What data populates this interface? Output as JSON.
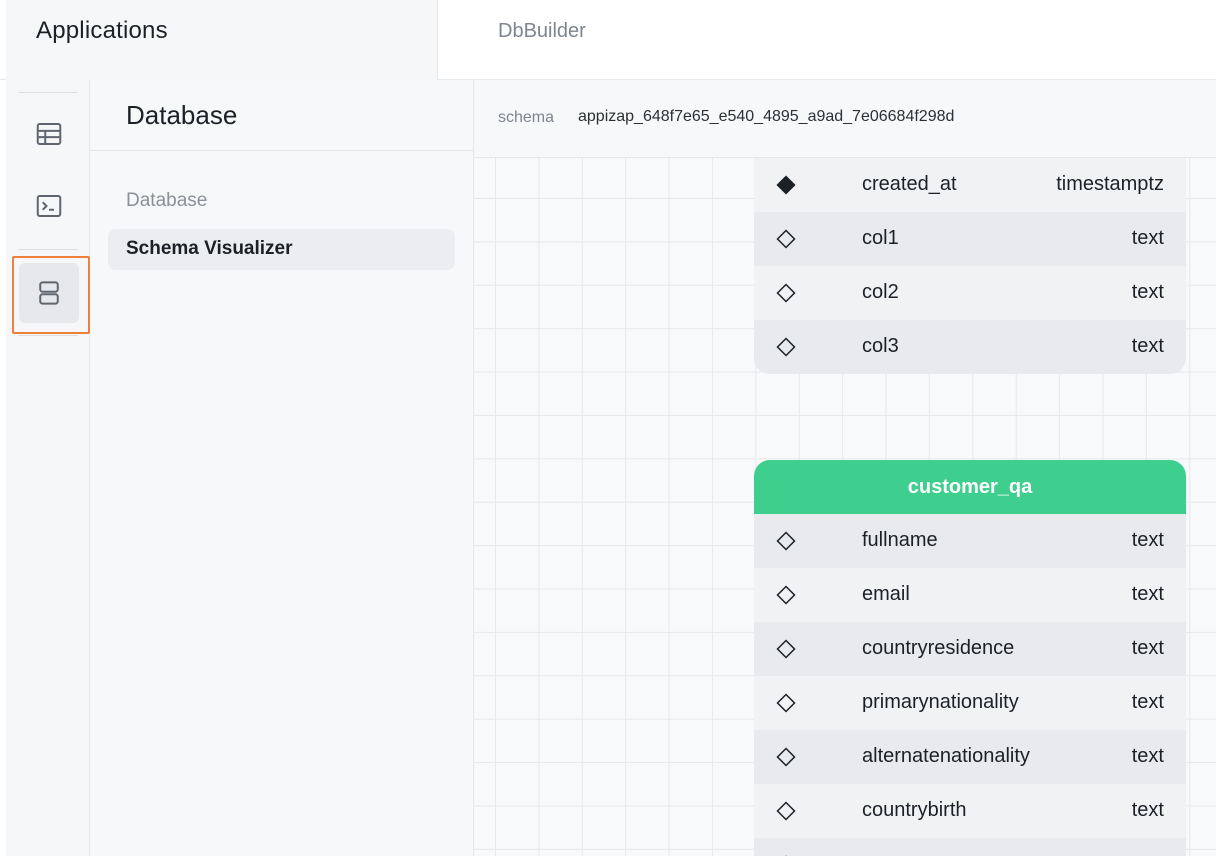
{
  "topbar": {
    "apps_title": "Applications",
    "app_name": "DbBuilder"
  },
  "rail": {
    "items": [
      {
        "icon": "table-icon",
        "active": false
      },
      {
        "icon": "terminal-icon",
        "active": false
      },
      {
        "icon": "database-icon",
        "active": true
      }
    ]
  },
  "sidebar": {
    "title": "Database",
    "section": "Database",
    "active_item": "Schema Visualizer"
  },
  "schema_bar": {
    "label": "schema",
    "value": "appizap_648f7e65_e540_4895_a9ad_7e06684f298d"
  },
  "colors": {
    "accent": "#3ecf8e",
    "focus_outline": "#ef7f3c"
  },
  "tables": [
    {
      "name": "",
      "columns": [
        {
          "name": "created_at",
          "type": "timestamptz",
          "icon": "filled-diamond-icon"
        },
        {
          "name": "col1",
          "type": "text",
          "icon": "diamond-icon"
        },
        {
          "name": "col2",
          "type": "text",
          "icon": "diamond-icon"
        },
        {
          "name": "col3",
          "type": "text",
          "icon": "diamond-icon"
        }
      ]
    },
    {
      "name": "customer_qa",
      "columns": [
        {
          "name": "fullname",
          "type": "text",
          "icon": "diamond-icon"
        },
        {
          "name": "email",
          "type": "text",
          "icon": "diamond-icon"
        },
        {
          "name": "countryresidence",
          "type": "text",
          "icon": "diamond-icon"
        },
        {
          "name": "primarynationality",
          "type": "text",
          "icon": "diamond-icon"
        },
        {
          "name": "alternatenationality",
          "type": "text",
          "icon": "diamond-icon"
        },
        {
          "name": "countrybirth",
          "type": "text",
          "icon": "diamond-icon"
        }
      ]
    }
  ]
}
